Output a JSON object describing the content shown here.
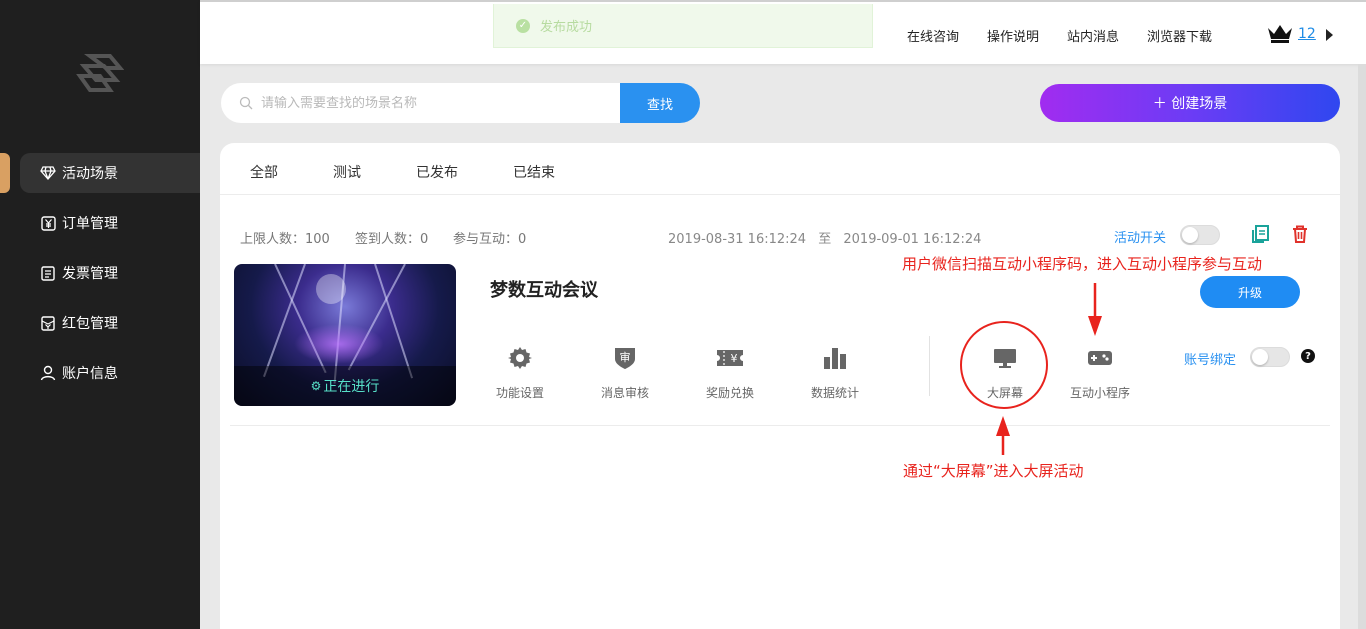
{
  "sidebar": {
    "items": [
      {
        "label": "活动场景",
        "icon": "diamond-icon",
        "active": true
      },
      {
        "label": "订单管理",
        "icon": "yen-icon",
        "active": false
      },
      {
        "label": "发票管理",
        "icon": "invoice-icon",
        "active": false
      },
      {
        "label": "红包管理",
        "icon": "red-packet-icon",
        "active": false
      },
      {
        "label": "账户信息",
        "icon": "user-icon",
        "active": false
      }
    ]
  },
  "toast": {
    "message": "发布成功"
  },
  "header": {
    "links": [
      "在线咨询",
      "操作说明",
      "站内消息",
      "浏览器下载"
    ],
    "vip_level": "12"
  },
  "search": {
    "placeholder": "请输入需要查找的场景名称",
    "button": "查找"
  },
  "create_button": "＋ 创建场景",
  "tabs": [
    "全部",
    "测试",
    "已发布",
    "已结束"
  ],
  "scene": {
    "limit": "上限人数：100",
    "signed": "签到人数：0",
    "participated": "参与互动：0",
    "start": "2019-08-31 16:12:24",
    "to": "至",
    "end": "2019-09-01 16:12:24",
    "switch_label": "活动开关",
    "title": "梦数互动会议",
    "status": "正在进行",
    "upgrade": "升级",
    "functions": [
      {
        "label": "功能设置",
        "icon": "gear-icon"
      },
      {
        "label": "消息审核",
        "icon": "shield-icon"
      },
      {
        "label": "奖励兑换",
        "icon": "ticket-icon"
      },
      {
        "label": "数据统计",
        "icon": "bar-chart-icon"
      },
      {
        "label": "大屏幕",
        "icon": "monitor-icon"
      },
      {
        "label": "互动小程序",
        "icon": "gamepad-icon"
      }
    ],
    "bind_label": "账号绑定",
    "help": "?"
  },
  "annotations": {
    "top": "用户微信扫描互动小程序码，进入互动小程序参与互动",
    "bottom": "通过“大屏幕”进入大屏活动"
  },
  "colors": {
    "accent": "#2a91f0",
    "annotation": "#e8231d",
    "sidebar": "#1f1f1f"
  }
}
